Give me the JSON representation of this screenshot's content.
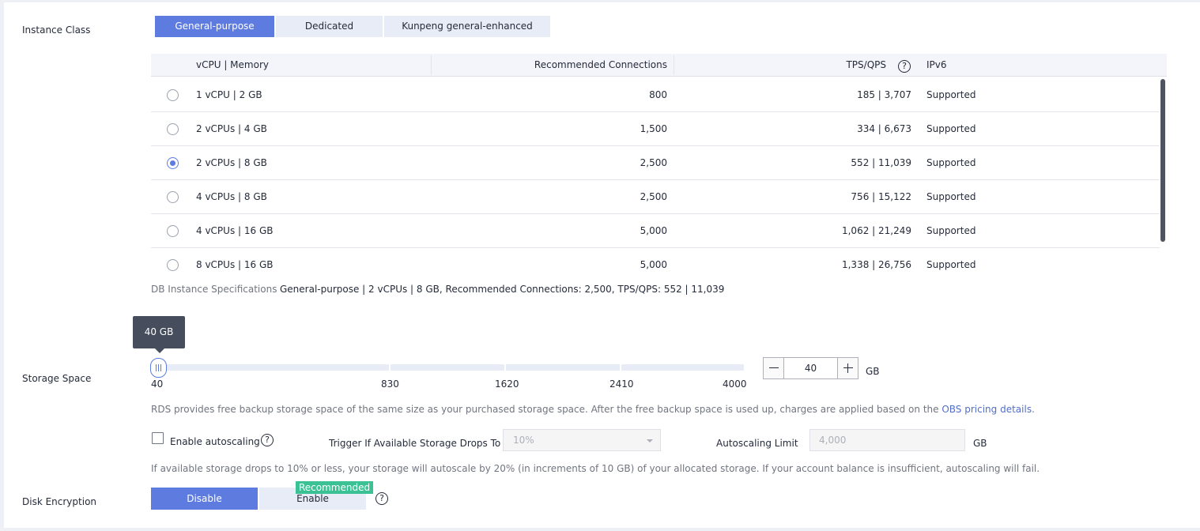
{
  "instance_class": {
    "label": "Instance Class",
    "options": [
      "General-purpose",
      "Dedicated",
      "Kunpeng general-enhanced"
    ],
    "selected": "General-purpose"
  },
  "table": {
    "headers": {
      "spec": "vCPU | Memory",
      "connections": "Recommended Connections",
      "tps": "TPS/QPS",
      "ipv6": "IPv6"
    },
    "rows": [
      {
        "spec": "1 vCPU | 2 GB",
        "connections": "800",
        "tps": "185 | 3,707",
        "ipv6": "Supported",
        "checked": false
      },
      {
        "spec": "2 vCPUs | 4 GB",
        "connections": "1,500",
        "tps": "334 | 6,673",
        "ipv6": "Supported",
        "checked": false
      },
      {
        "spec": "2 vCPUs | 8 GB",
        "connections": "2,500",
        "tps": "552 | 11,039",
        "ipv6": "Supported",
        "checked": true
      },
      {
        "spec": "4 vCPUs | 8 GB",
        "connections": "2,500",
        "tps": "756 | 15,122",
        "ipv6": "Supported",
        "checked": false
      },
      {
        "spec": "4 vCPUs | 16 GB",
        "connections": "5,000",
        "tps": "1,062 | 21,249",
        "ipv6": "Supported",
        "checked": false
      },
      {
        "spec": "8 vCPUs | 16 GB",
        "connections": "5,000",
        "tps": "1,338 | 26,756",
        "ipv6": "Supported",
        "checked": false
      }
    ]
  },
  "spec_summary": {
    "label": "DB Instance Specifications",
    "value": "General-purpose | 2 vCPUs | 8 GB, Recommended Connections: 2,500, TPS/QPS: 552 | 11,039"
  },
  "storage": {
    "label": "Storage Space",
    "tooltip": "40 GB",
    "ticks": [
      "40",
      "830",
      "1620",
      "2410",
      "4000"
    ],
    "value": "40",
    "min": 40,
    "max": 4000,
    "unit": "GB"
  },
  "backup_note": {
    "text": "RDS provides free backup storage space of the same size as your purchased storage space. After the free backup space is used up, charges are applied based on the ",
    "link": "OBS pricing details",
    "end": "."
  },
  "autoscaling": {
    "checkbox_label": "Enable autoscaling",
    "checked": false,
    "trigger_label": "Trigger If Available Storage Drops To",
    "trigger_value": "10%",
    "limit_label": "Autoscaling Limit",
    "limit_placeholder": "4,000",
    "limit_unit": "GB",
    "note": "If available storage drops to 10% or less, your storage will autoscale by 20% (in increments of 10 GB) of your allocated storage. If your account balance is insufficient, autoscaling will fail."
  },
  "disk_encryption": {
    "label": "Disk Encryption",
    "disable_label": "Disable",
    "enable_label": "Enable",
    "badge": "Recommended",
    "selected": "Disable"
  },
  "icons": {
    "help": "help-circle-icon",
    "radio": "radio-icon",
    "checkbox": "checkbox-icon"
  },
  "colors": {
    "accent": "#5e7ce0",
    "badge": "#3ac295",
    "link": "#526ecc",
    "tooltip": "#464d5c"
  }
}
